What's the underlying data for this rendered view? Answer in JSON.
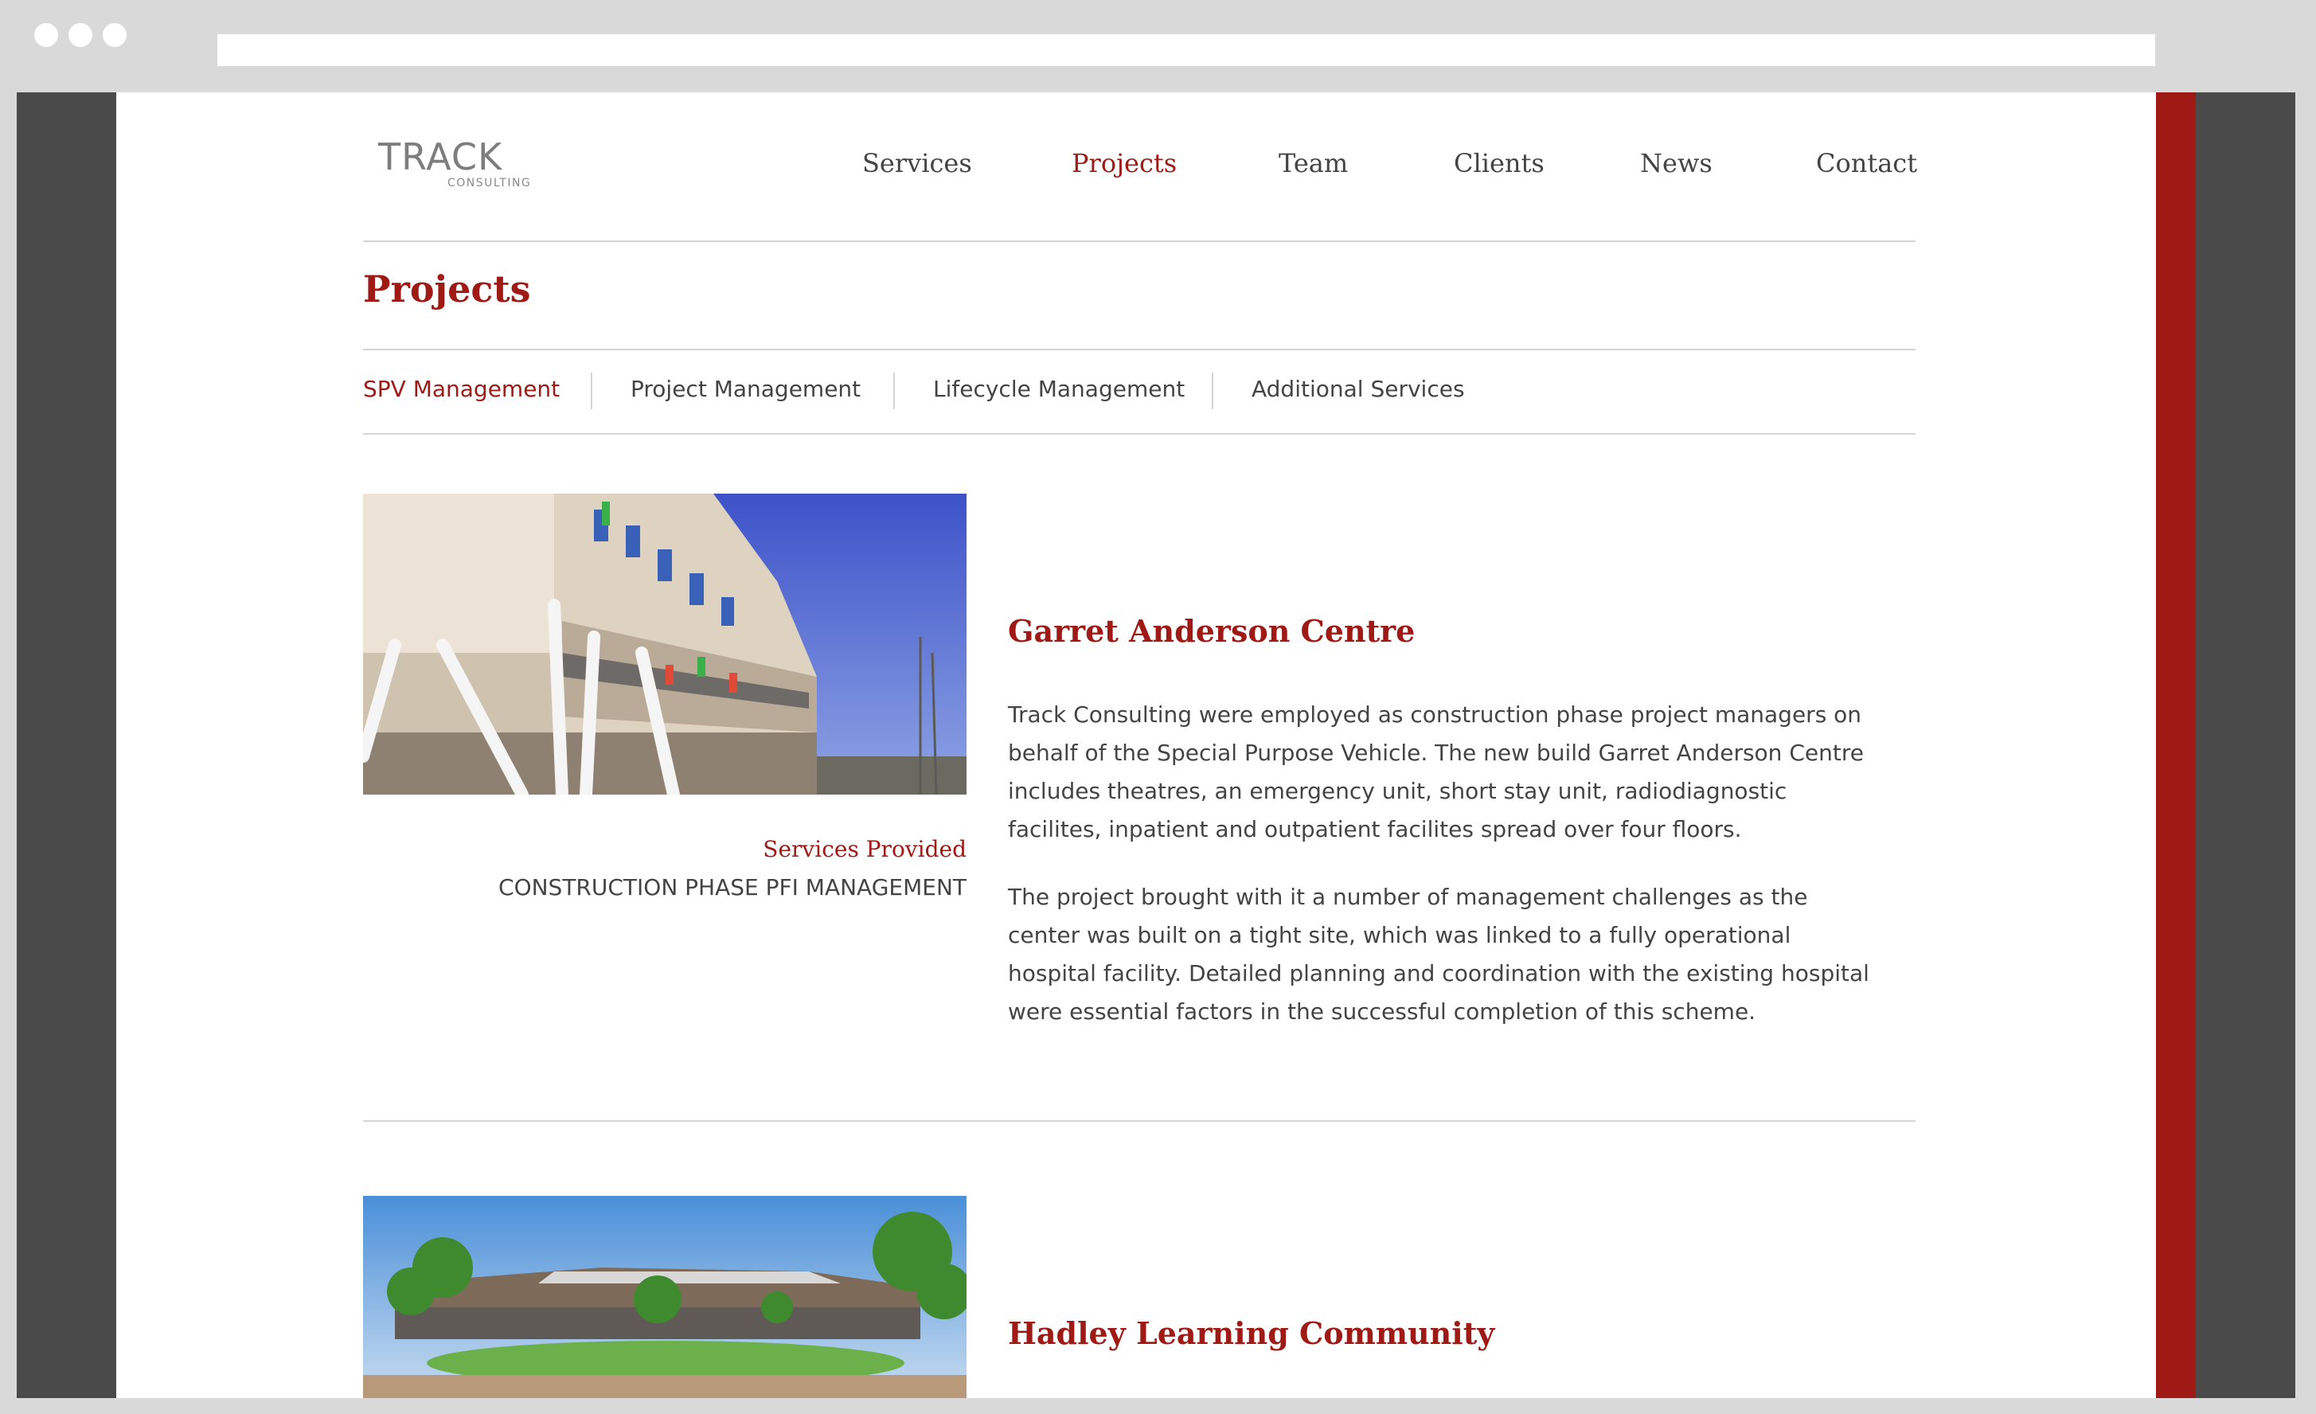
{
  "browser": {
    "url": ""
  },
  "header": {
    "logo_main": "TRACK",
    "logo_sub": "CONSULTING",
    "nav": [
      {
        "label": "Services",
        "active": false
      },
      {
        "label": "Projects",
        "active": true
      },
      {
        "label": "Team",
        "active": false
      },
      {
        "label": "Clients",
        "active": false
      },
      {
        "label": "News",
        "active": false
      },
      {
        "label": "Contact",
        "active": false
      }
    ]
  },
  "page": {
    "title": "Projects",
    "subnav": [
      {
        "label": "SPV Management",
        "active": true
      },
      {
        "label": "Project Management",
        "active": false
      },
      {
        "label": "Lifecycle Management",
        "active": false
      },
      {
        "label": "Additional Services",
        "active": false
      }
    ]
  },
  "projects": [
    {
      "title": "Garret Anderson Centre",
      "services_heading": "Services Provided",
      "services_value": "CONSTRUCTION PHASE PFI MANAGEMENT",
      "paragraphs": [
        "Track Consulting were employed as construction phase project managers on behalf of the Special Purpose Vehicle. The new build Garret Anderson Centre includes theatres, an emergency unit, short stay unit, radiodiagnostic facilites, inpatient and outpatient facilites spread over four floors.",
        "The project brought with it a number of management challenges as the center was built on a tight site, which was linked to a fully operational hospital facility. Detailed planning and coordination with the existing hospital were essential factors in the successful completion of this scheme."
      ]
    },
    {
      "title": "Hadley Learning Community"
    }
  ],
  "colors": {
    "accent": "#a01a15",
    "text": "#444444",
    "frame": "#4a4a4a",
    "chrome": "#d9d9d9"
  }
}
